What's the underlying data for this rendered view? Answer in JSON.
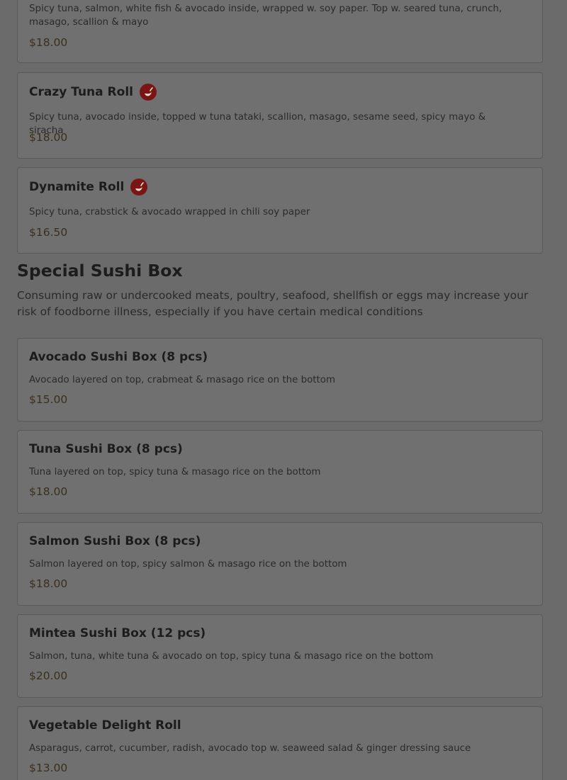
{
  "top_item": {
    "description": "Spicy tuna, salmon, white fish & avocado inside, wrapped w. soy paper. Top w. seared tuna, crunch, masago, scallion & mayo",
    "price": "$18.00"
  },
  "rolls": [
    {
      "name": "Crazy Tuna Roll",
      "spicy": true,
      "description": "Spicy tuna, avocado inside, topped w tuna tataki, scallion, masago, sesame seed, spicy mayo & siracha",
      "price": "$18.00"
    },
    {
      "name": "Dynamite Roll",
      "spicy": true,
      "description": "Spicy tuna, crabstick & avocado wrapped in chili soy paper",
      "price": "$16.50"
    }
  ],
  "special_section": {
    "title": "Special Sushi Box",
    "note": "Consuming raw or undercooked meats, poultry, seafood, shellfish or eggs may increase your risk of foodborne illness, especially if you have certain medical conditions",
    "items": [
      {
        "name": "Avocado Sushi Box (8 pcs)",
        "description": "Avocado layered on top, crabmeat & masago rice on the bottom",
        "price": "$15.00"
      },
      {
        "name": "Tuna Sushi Box (8 pcs)",
        "description": "Tuna layered on top, spicy tuna & masago rice on the bottom",
        "price": "$18.00"
      },
      {
        "name": "Salmon Sushi Box (8 pcs)",
        "description": "Salmon layered on top, spicy salmon & masago rice on the bottom",
        "price": "$18.00"
      },
      {
        "name": "Mintea Sushi Box (12 pcs)",
        "description": "Salmon, tuna, white tuna & avocado on top, spicy tuna & masago rice on the bottom",
        "price": "$20.00"
      },
      {
        "name": "Vegetable Delight Roll",
        "description": "Asparagus, carrot, cucumber, radish, avocado top w. seaweed salad & ginger dressing sauce",
        "price": "$13.00"
      }
    ]
  },
  "icons": {
    "spicy": "chili-pepper-icon"
  },
  "colors": {
    "spicy_badge": "#7a1515",
    "price": "#3b2f1c",
    "overlay": "#6b6b6b"
  }
}
